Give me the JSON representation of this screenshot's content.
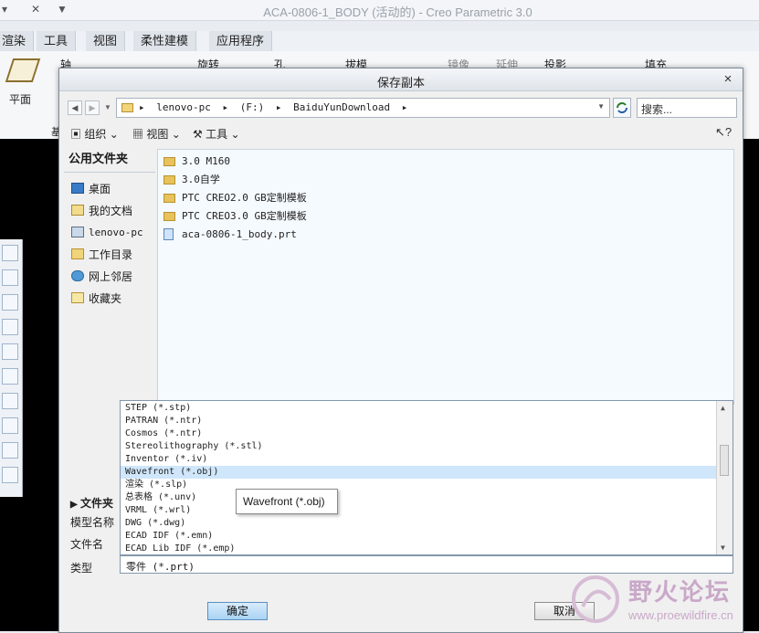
{
  "app": {
    "title": "ACA-0806-1_BODY (活动的) - Creo Parametric 3.0",
    "ribbon_tabs": [
      "渲染",
      "工具",
      "视图",
      "柔性建模",
      "应用程序"
    ],
    "ribbon_items": [
      "轴",
      "平面",
      "旋转",
      "孔",
      "拔模",
      "镜像",
      "延伸",
      "投影",
      "填充"
    ],
    "ribbon_group_label": "基"
  },
  "dialog": {
    "title": "保存副本",
    "close_glyph": "×",
    "address": [
      "lenovo-pc",
      "(F:)",
      "BaiduYunDownload"
    ],
    "search_placeholder": "搜索...",
    "toolbar": {
      "organize": "组织",
      "view": "视图",
      "tools": "工具"
    },
    "sidebar": {
      "header": "公用文件夹",
      "items": [
        {
          "label": "桌面",
          "icon": "desktop-icon"
        },
        {
          "label": "我的文档",
          "icon": "documents-icon"
        },
        {
          "label": "lenovo-pc",
          "icon": "computer-icon"
        },
        {
          "label": "工作目录",
          "icon": "working-directory-icon"
        },
        {
          "label": "网上邻居",
          "icon": "network-icon"
        },
        {
          "label": "收藏夹",
          "icon": "favorites-icon"
        }
      ]
    },
    "files": [
      {
        "name": "3.0 M160",
        "type": "folder"
      },
      {
        "name": "3.0自学",
        "type": "folder"
      },
      {
        "name": "PTC CREO2.0 GB定制模板",
        "type": "folder"
      },
      {
        "name": "PTC CREO3.0 GB定制模板",
        "type": "folder"
      },
      {
        "name": "aca-0806-1_body.prt",
        "type": "part"
      }
    ],
    "bottom": {
      "folder_tree_label": "文件夹",
      "model_name_label": "模型名称",
      "file_name_label": "文件名",
      "type_label": "类型",
      "type_value": "零件 (*.prt)"
    },
    "type_options": [
      "STEP (*.stp)",
      "PATRAN (*.ntr)",
      "Cosmos (*.ntr)",
      "Stereolithography (*.stl)",
      "Inventor (*.iv)",
      "Wavefront (*.obj)",
      "渲染 (*.slp)",
      "总表格 (*.unv)",
      "VRML (*.wrl)",
      "DWG (*.dwg)",
      "ECAD IDF (*.emn)",
      "ECAD Lib IDF (*.emp)"
    ],
    "selected_option_index": 5,
    "tooltip": "Wavefront (*.obj)",
    "ok_label": "确定",
    "cancel_label": "取消"
  },
  "watermark": {
    "text": "野火论坛",
    "url": "www.proewildfire.cn"
  }
}
